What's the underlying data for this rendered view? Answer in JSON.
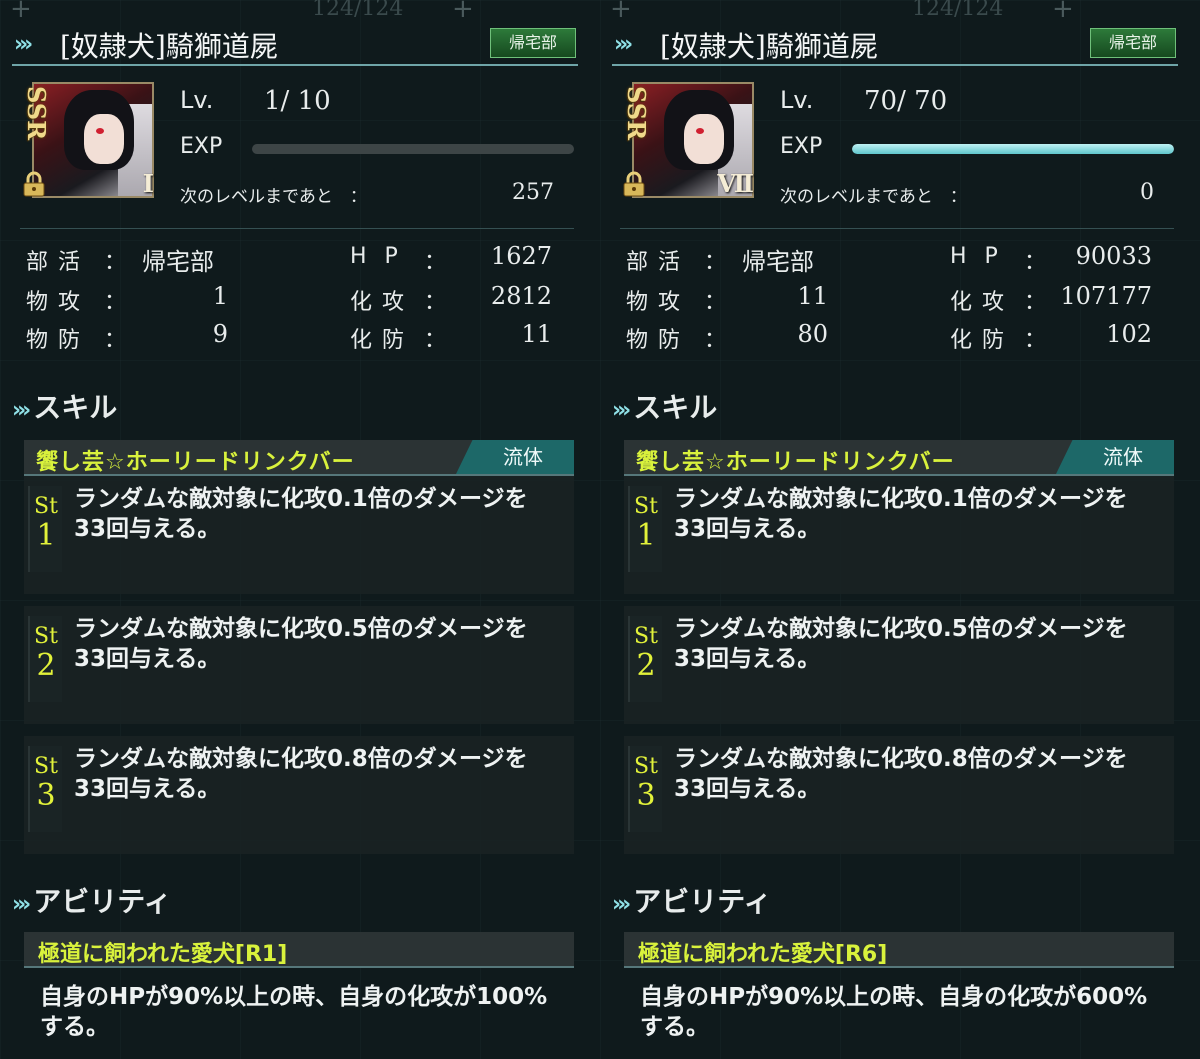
{
  "cards": [
    {
      "ghost_text": "124/124",
      "title": "[奴隷犬]騎獅道屍",
      "club_badge": "帰宅部",
      "rarity": "SSR",
      "rank": "Ⅰ",
      "level_label": "Lv.",
      "level_value": "1/  10",
      "exp_label": "EXP",
      "exp_progress": 0.0,
      "next_level_label": "次のレベルまであと　：",
      "next_level_value": "257",
      "stats": {
        "club_label": "部活",
        "club_value": "帰宅部",
        "hp_label": "HP",
        "hp_value": "1627",
        "patk_label": "物攻",
        "patk_value": "1",
        "matk_label": "化攻",
        "matk_value": "2812",
        "pdef_label": "物防",
        "pdef_value": "9",
        "mdef_label": "化防",
        "mdef_value": "11"
      },
      "skill_heading": "スキル",
      "skill_name": "饗し芸☆ホーリードリンクバー",
      "skill_type": "流体",
      "stages": [
        {
          "tag": "St",
          "num": "1",
          "text": "ランダムな敵対象に化攻0.1倍のダメージを33回与える。"
        },
        {
          "tag": "St",
          "num": "2",
          "text": "ランダムな敵対象に化攻0.5倍のダメージを33回与える。"
        },
        {
          "tag": "St",
          "num": "3",
          "text": "ランダムな敵対象に化攻0.8倍のダメージを33回与える。"
        }
      ],
      "ability_heading": "アビリティ",
      "ability_name": "極道に飼われた愛犬[R1]",
      "ability_text": "自身のHPが90%以上の時、自身の化攻が100%する。"
    },
    {
      "ghost_text": "124/124",
      "title": "[奴隷犬]騎獅道屍",
      "club_badge": "帰宅部",
      "rarity": "SSR",
      "rank": "Ⅶ",
      "level_label": "Lv.",
      "level_value": "70/  70",
      "exp_label": "EXP",
      "exp_progress": 1.0,
      "next_level_label": "次のレベルまであと　：",
      "next_level_value": "0",
      "stats": {
        "club_label": "部活",
        "club_value": "帰宅部",
        "hp_label": "HP",
        "hp_value": "90033",
        "patk_label": "物攻",
        "patk_value": "11",
        "matk_label": "化攻",
        "matk_value": "107177",
        "pdef_label": "物防",
        "pdef_value": "80",
        "mdef_label": "化防",
        "mdef_value": "102"
      },
      "skill_heading": "スキル",
      "skill_name": "饗し芸☆ホーリードリンクバー",
      "skill_type": "流体",
      "stages": [
        {
          "tag": "St",
          "num": "1",
          "text": "ランダムな敵対象に化攻0.1倍のダメージを33回与える。"
        },
        {
          "tag": "St",
          "num": "2",
          "text": "ランダムな敵対象に化攻0.5倍のダメージを33回与える。"
        },
        {
          "tag": "St",
          "num": "3",
          "text": "ランダムな敵対象に化攻0.8倍のダメージを33回与える。"
        }
      ],
      "ability_heading": "アビリティ",
      "ability_name": "極道に飼われた愛犬[R6]",
      "ability_text": "自身のHPが90%以上の時、自身の化攻が600%する。"
    }
  ],
  "icons": {
    "chevron": "triple-chevron-icon",
    "lock": "padlock-icon",
    "plus": "plus-icon"
  },
  "colors": {
    "accent_yellow": "#d9f23c",
    "exp_fill": "#5fc6cc",
    "badge_green": "#2d7a3a",
    "skill_type_teal": "#1d6868"
  }
}
